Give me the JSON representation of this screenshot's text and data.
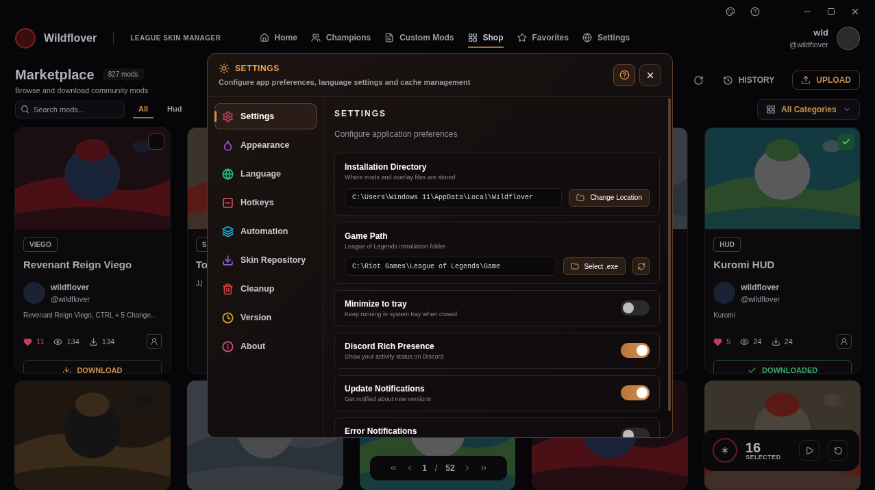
{
  "app": {
    "brand": "Wildflover",
    "tagline": "LEAGUE SKIN MANAGER",
    "nav": [
      {
        "label": "Home",
        "selected": false
      },
      {
        "label": "Champions",
        "selected": false
      },
      {
        "label": "Custom Mods",
        "selected": false
      },
      {
        "label": "Shop",
        "selected": true
      },
      {
        "label": "Favorites",
        "selected": false
      },
      {
        "label": "Settings",
        "selected": false
      }
    ],
    "user": {
      "name": "wld",
      "handle": "@wildflover"
    },
    "page_title": "Marketplace",
    "count_badge": "827 mods",
    "page_subtitle": "Browse and download community mods",
    "history_button": "HISTORY",
    "upload_button": "UPLOAD",
    "search": {
      "placeholder": "Search mods..."
    },
    "filters": [
      {
        "label": "All",
        "selected": true
      },
      {
        "label": "Hud",
        "selected": false
      }
    ],
    "category_select": "All Categories",
    "cards": [
      {
        "kind": "mod",
        "tag": "VIEGO",
        "title": "Revenant Reign Viego",
        "author": "wildflover",
        "handle": "@wildflover",
        "description": "Revenant Reign Viego, CTRL + 5 Change...",
        "likes": "11",
        "views": "134",
        "downloads": "134",
        "action": "DOWNLOAD",
        "downloaded": false,
        "checked": false
      },
      {
        "kind": "mod",
        "tag": "S",
        "title": "To",
        "description": "JJ"
      },
      {
        "kind": "picture"
      },
      {
        "kind": "mod",
        "tag": "HUD",
        "title": "Kuromi HUD",
        "author": "wildflover",
        "handle": "@wildflover",
        "description": "Kuromi",
        "likes": "5",
        "views": "24",
        "downloads": "24",
        "action": "DOWNLOADED",
        "downloaded": true,
        "checked": true
      }
    ],
    "pagination": {
      "current": "1",
      "separator": "/",
      "total": "52"
    },
    "selection": {
      "count": "16",
      "label": "SELECTED"
    }
  },
  "dialog": {
    "title": "SETTINGS",
    "subtitle": "Configure app preferences, language settings and cache management",
    "sidebar": [
      {
        "label": "Settings",
        "color": "#b8405a",
        "selected": true
      },
      {
        "label": "Appearance",
        "color": "#9b4bd6",
        "selected": false
      },
      {
        "label": "Language",
        "color": "#22b884",
        "selected": false
      },
      {
        "label": "Hotkeys",
        "color": "#d04656",
        "selected": false
      },
      {
        "label": "Automation",
        "color": "#23a3c6",
        "selected": false
      },
      {
        "label": "Skin Repository",
        "color": "#8a5ce0",
        "selected": false
      },
      {
        "label": "Cleanup",
        "color": "#d23a3a",
        "selected": false
      },
      {
        "label": "Version",
        "color": "#d2a418",
        "selected": false
      },
      {
        "label": "About",
        "color": "#d04a8a",
        "selected": false
      }
    ],
    "section_title": "SETTINGS",
    "section_subtitle": "Configure application preferences",
    "settings": [
      {
        "kind": "path",
        "title": "Installation Directory",
        "description": "Where mods and overlay files are stored",
        "value": "C:\\Users\\Windows 11\\AppData\\Local\\Wildflover",
        "button": "Change Location",
        "refresh": false
      },
      {
        "kind": "path",
        "title": "Game Path",
        "description": "League of Legends installation folder",
        "value": "C:\\Riot Games\\League of Legends\\Game",
        "button": "Select .exe",
        "refresh": true
      },
      {
        "kind": "toggle",
        "title": "Minimize to tray",
        "description": "Keep running in system tray when closed",
        "on": false
      },
      {
        "kind": "toggle",
        "title": "Discord Rich Presence",
        "description": "Show your activity status on Discord",
        "on": true
      },
      {
        "kind": "toggle",
        "title": "Update Notifications",
        "description": "Get notified about new versions",
        "on": true
      },
      {
        "kind": "toggle",
        "title": "Error Notifications",
        "on": false
      }
    ]
  }
}
